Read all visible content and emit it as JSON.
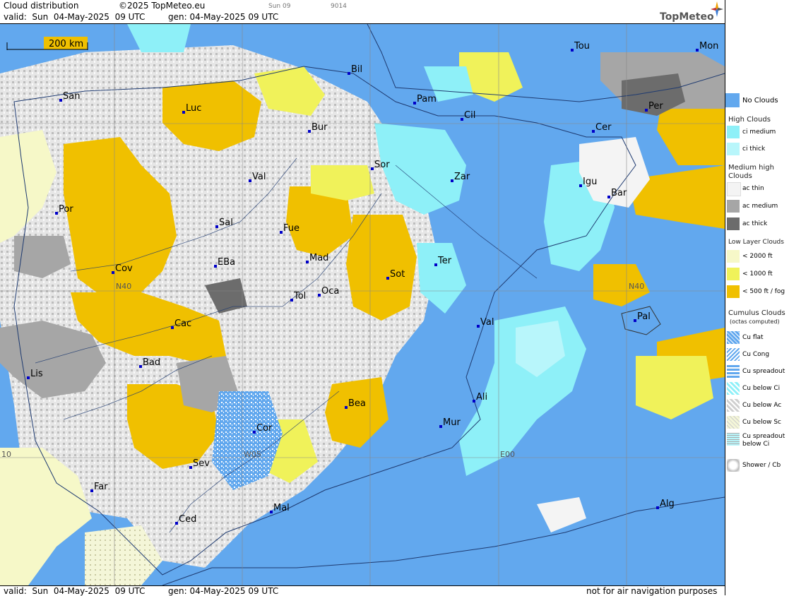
{
  "header": {
    "title": "Cloud distribution",
    "copyright": "©2025 TopMeteo.eu",
    "valid": "valid:  Sun  04-May-2025  09 UTC",
    "gen": "gen: 04-May-2025 09 UTC",
    "tab_day": "Sun 09",
    "code": "9014",
    "logo": "TopMeteo"
  },
  "footer": {
    "valid": "valid:  Sun  04-May-2025  09 UTC",
    "gen": "gen: 04-May-2025 09 UTC",
    "disclaimer": "not for air navigation purposes"
  },
  "scale": {
    "label": "200 km"
  },
  "grid_labels": {
    "n40_left": "N40",
    "n40_right": "N40",
    "w05": "W05",
    "e00": "E00",
    "w10": "10"
  },
  "cities": [
    {
      "name": "San"
    },
    {
      "name": "Luc"
    },
    {
      "name": "Bil"
    },
    {
      "name": "Pam"
    },
    {
      "name": "Cil"
    },
    {
      "name": "Tou"
    },
    {
      "name": "Mon"
    },
    {
      "name": "Per"
    },
    {
      "name": "Cer"
    },
    {
      "name": "Bur"
    },
    {
      "name": "Sor"
    },
    {
      "name": "Zar"
    },
    {
      "name": "Igu"
    },
    {
      "name": "Bar"
    },
    {
      "name": "Val"
    },
    {
      "name": "Por"
    },
    {
      "name": "Sal"
    },
    {
      "name": "Fue"
    },
    {
      "name": "Mad"
    },
    {
      "name": "Cov"
    },
    {
      "name": "EBa"
    },
    {
      "name": "Tol"
    },
    {
      "name": "Oca"
    },
    {
      "name": "Sot"
    },
    {
      "name": "Ter"
    },
    {
      "name": "Cac"
    },
    {
      "name": "Val"
    },
    {
      "name": "Pal"
    },
    {
      "name": "Lis"
    },
    {
      "name": "Bad"
    },
    {
      "name": "Bea"
    },
    {
      "name": "Ali"
    },
    {
      "name": "Mur"
    },
    {
      "name": "Cor"
    },
    {
      "name": "Sev"
    },
    {
      "name": "Far"
    },
    {
      "name": "Mal"
    },
    {
      "name": "Ced"
    },
    {
      "name": "Alg"
    }
  ],
  "legend": {
    "no_clouds": "No Clouds",
    "high_clouds": "High Clouds",
    "ci_medium": "ci medium",
    "ci_thick": "ci thick",
    "medium_high_1": "Medium high",
    "medium_high_2": "Clouds",
    "ac_thin": "ac thin",
    "ac_medium": "ac medium",
    "ac_thick": "ac thick",
    "low_layer": "Low Layer Clouds",
    "low_2000": "< 2000 ft",
    "low_1000": "< 1000 ft",
    "low_500": "< 500 ft / fog",
    "cumulus_1": "Cumulus Clouds",
    "cumulus_2": "(octas computed)",
    "cu_flat": "Cu flat",
    "cu_cong": "Cu Cong",
    "cu_spreadout": "Cu spreadout",
    "cu_below_ci": "Cu below Ci",
    "cu_below_ac": "Cu below Ac",
    "cu_below_sc": "Cu below Sc",
    "cu_spread_ci_1": "Cu spreadout",
    "cu_spread_ci_2": "below Ci",
    "shower": "Shower / Cb"
  },
  "colors": {
    "no_clouds": "#62a8ee",
    "ci_medium": "#8ef0f8",
    "ci_thick": "#b8f6fb",
    "ac_thin": "#f4f4f4",
    "ac_medium": "#a6a6a6",
    "ac_thick": "#6c6c6c",
    "low_2000": "#f6f8c8",
    "low_1000": "#f0f25a",
    "low_500": "#f0c000",
    "cu_below_ac": "#cfcfcf"
  }
}
